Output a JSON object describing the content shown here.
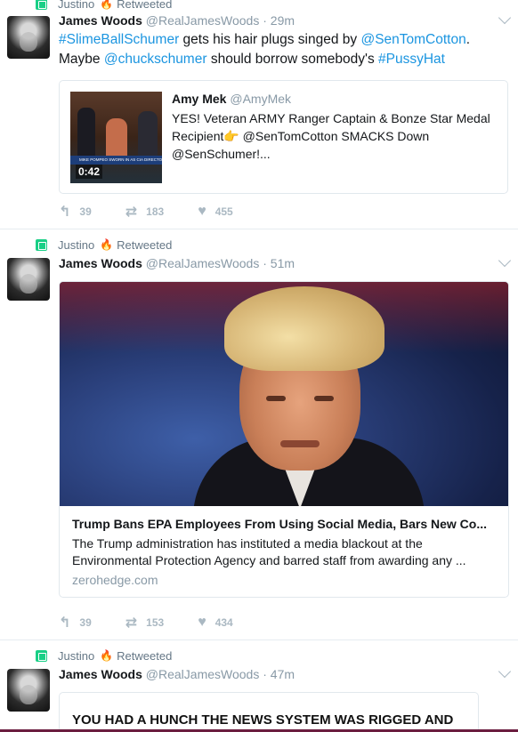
{
  "tweets": [
    {
      "retweeter": "Justino",
      "retweeted_label": "Retweeted",
      "name": "James Woods",
      "handle": "@RealJamesWoods",
      "time": "29m",
      "text_parts": [
        {
          "t": "#SlimeBallSchumer",
          "link": true
        },
        {
          "t": " gets his hair plugs singed by ",
          "link": false
        },
        {
          "t": "@SenTomCotton",
          "link": true
        },
        {
          "t": ". Maybe ",
          "link": false
        },
        {
          "t": "@chuckschumer",
          "link": true
        },
        {
          "t": " should borrow somebody's ",
          "link": false
        },
        {
          "t": "#PussyHat",
          "link": true
        }
      ],
      "quote": {
        "name": "Amy Mek",
        "handle": "@AmyMek",
        "text": "YES! Veteran ARMY Ranger Captain & Bonze Star Medal Recipient👉 @SenTomCotton SMACKS Down @SenSchumer!...",
        "video_duration": "0:42",
        "chyron": "MIKE POMPEO SWORN IN AS CIA DIRECTOR"
      },
      "replies": "39",
      "retweets": "183",
      "likes": "455"
    },
    {
      "retweeter": "Justino",
      "retweeted_label": "Retweeted",
      "name": "James Woods",
      "handle": "@RealJamesWoods",
      "time": "51m",
      "card": {
        "title": "Trump Bans EPA Employees From Using Social Media, Bars New Co...",
        "description": "The Trump administration has instituted a media blackout at the Environmental Protection Agency and barred staff from awarding any ...",
        "domain": "zerohedge.com"
      },
      "replies": "39",
      "retweets": "153",
      "likes": "434"
    },
    {
      "retweeter": "Justino",
      "retweeted_label": "Retweeted",
      "name": "James Woods",
      "handle": "@RealJamesWoods",
      "time": "47m",
      "image_text": "YOU HAD A HUNCH THE NEWS SYSTEM WAS RIGGED AND"
    }
  ],
  "colors": {
    "link": "#1b95e0",
    "retweet_green": "#19cf86",
    "muted": "#8899a6"
  }
}
